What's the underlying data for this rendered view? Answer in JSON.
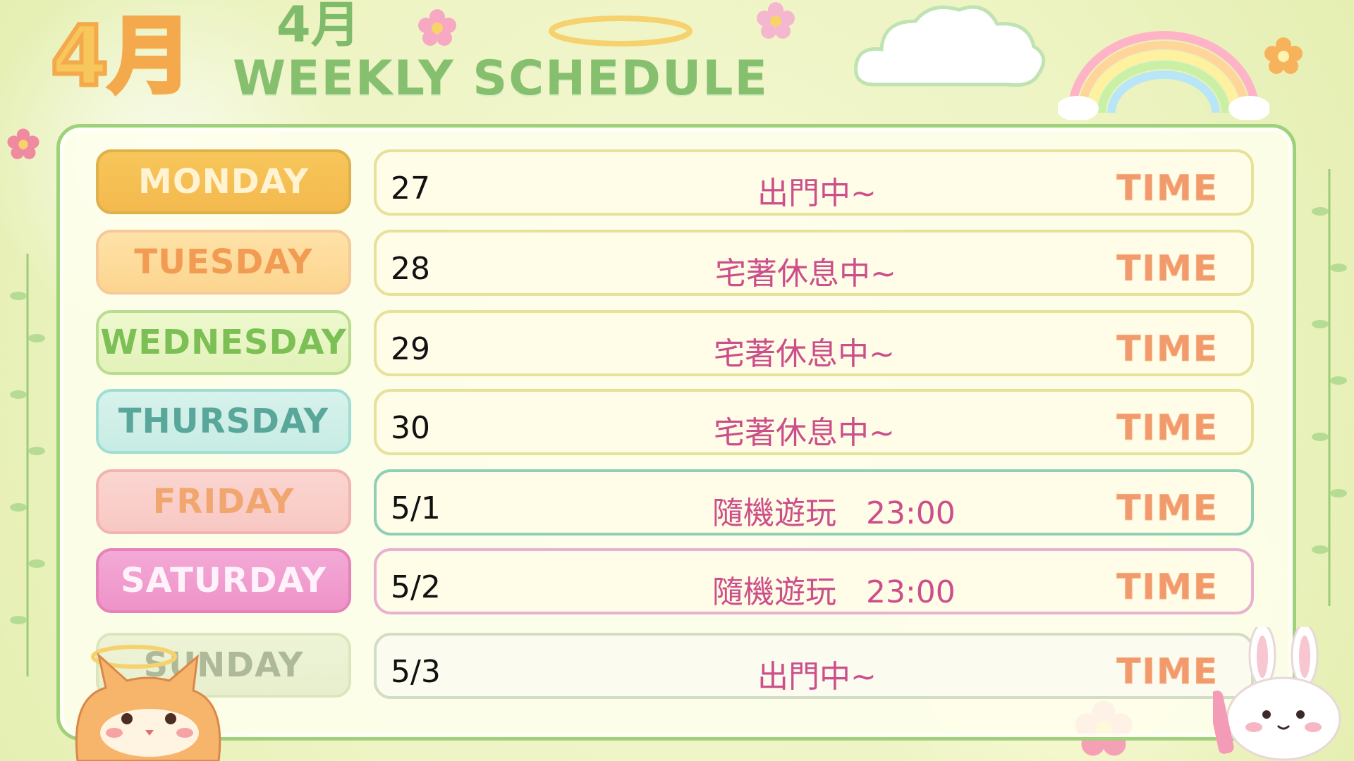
{
  "header": {
    "month_large": "4月",
    "month_small": "4月",
    "title": "WEEKLY SCHEDULE"
  },
  "schedule": [
    {
      "day": "MONDAY",
      "date": "27",
      "event": "出門中~",
      "time_label": "TIME"
    },
    {
      "day": "TUESDAY",
      "date": "28",
      "event": "宅著休息中~",
      "time_label": "TIME"
    },
    {
      "day": "WEDNESDAY",
      "date": "29",
      "event": "宅著休息中~",
      "time_label": "TIME"
    },
    {
      "day": "THURSDAY",
      "date": "30",
      "event": "宅著休息中~",
      "time_label": "TIME"
    },
    {
      "day": "FRIDAY",
      "date": "5/1",
      "event": "隨機遊玩   23:00",
      "time_label": "TIME"
    },
    {
      "day": "SATURDAY",
      "date": "5/2",
      "event": "隨機遊玩   23:00",
      "time_label": "TIME"
    },
    {
      "day": "SUNDAY",
      "date": "5/3",
      "event": "出門中~",
      "time_label": "TIME"
    }
  ],
  "colors": {
    "event_text": "#cc4f8a",
    "time_text": "#f29a6b",
    "board_border": "#9fd17b"
  }
}
